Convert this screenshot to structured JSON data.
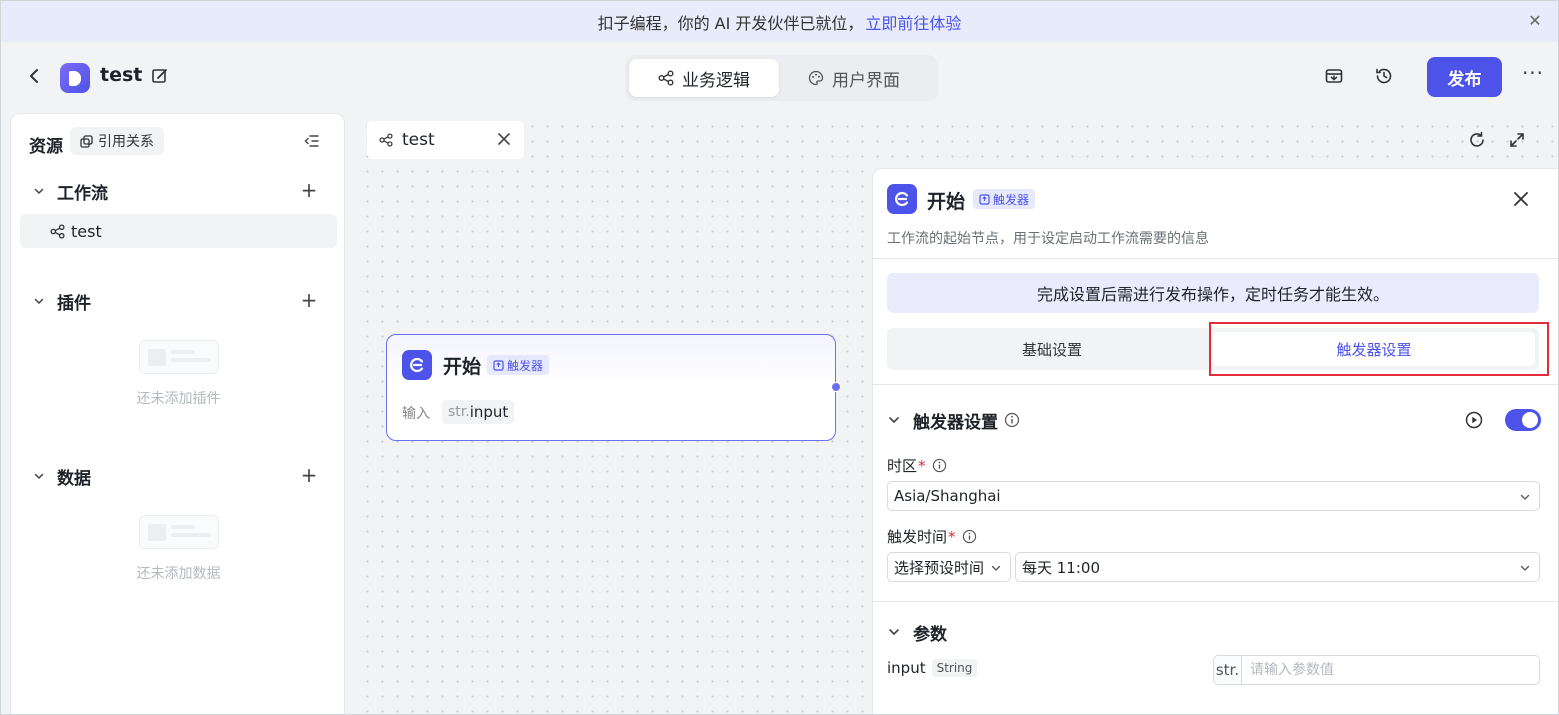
{
  "banner": {
    "text": "扣子编程，你的 AI 开发伙伴已就位，",
    "link": "立即前往体验"
  },
  "header": {
    "app_name": "test",
    "tabs": [
      {
        "label": "业务逻辑",
        "icon": "workflow-icon",
        "active": true
      },
      {
        "label": "用户界面",
        "icon": "palette-icon",
        "active": false
      }
    ],
    "publish_label": "发布",
    "more_label": "···"
  },
  "sidebar": {
    "title": "资源",
    "ref_label": "引用关系",
    "sections": [
      {
        "label": "工作流",
        "items": [
          "test"
        ]
      },
      {
        "label": "插件",
        "empty_text": "还未添加插件"
      },
      {
        "label": "数据",
        "empty_text": "还未添加数据"
      }
    ]
  },
  "canvas": {
    "tab_label": "test",
    "node": {
      "title": "开始",
      "badge": "触发器",
      "input_label": "输入",
      "input_type_prefix": "str.",
      "input_name": "input"
    }
  },
  "panel": {
    "title": "开始",
    "badge": "触发器",
    "description": "工作流的起始节点，用于设定启动工作流需要的信息",
    "notice": "完成设置后需进行发布操作，定时任务才能生效。",
    "tabs": [
      {
        "label": "基础设置",
        "active": false
      },
      {
        "label": "触发器设置",
        "active": true
      }
    ],
    "trigger_section": {
      "label": "触发器设置",
      "enabled": true,
      "timezone_label": "时区",
      "timezone_value": "Asia/Shanghai",
      "time_label": "触发时间",
      "preset_value": "选择预设时间",
      "time_value": "每天 11:00"
    },
    "params_section": {
      "label": "参数",
      "param_name": "input",
      "param_type": "String",
      "input_prefix": "str.",
      "input_placeholder": "请输入参数值"
    }
  },
  "colors": {
    "accent": "#4d53e8",
    "highlight_border": "#e02d3c",
    "banner_bg": "#e8ebfa"
  }
}
